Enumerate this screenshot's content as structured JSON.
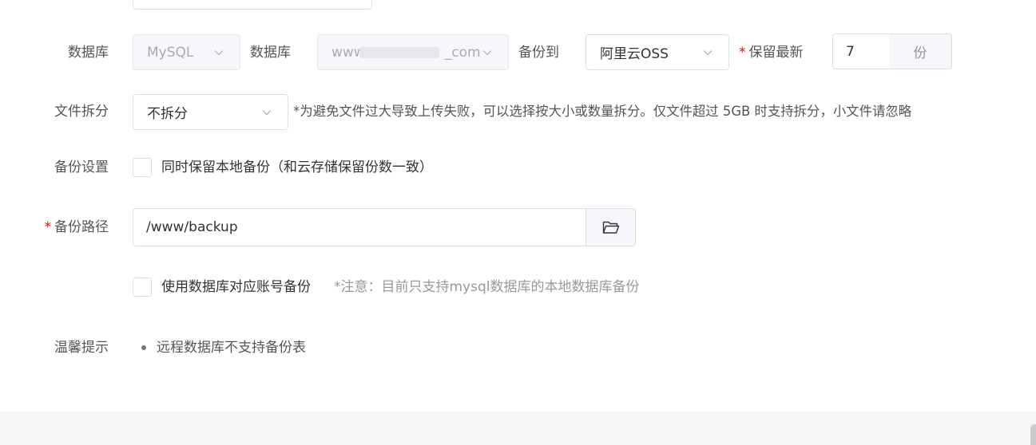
{
  "row_db": {
    "label": "数据库",
    "db_type": {
      "value": "MySQL"
    },
    "db_label": "数据库",
    "db_name": {
      "prefix": "www",
      "suffix": "_com"
    },
    "backup_to_label": "备份到",
    "backup_to": {
      "value": "阿里云OSS"
    },
    "keep_label": "保留最新",
    "keep_count": {
      "value": "7",
      "unit": "份"
    }
  },
  "row_split": {
    "label": "文件拆分",
    "value": "不拆分",
    "hint": "*为避免文件过大导致上传失败，可以选择按大小或数量拆分。仅文件超过 5GB 时支持拆分，小文件请忽略"
  },
  "row_backup_setting": {
    "label": "备份设置",
    "checkbox_label": "同时保留本地备份（和云存储保留份数一致）"
  },
  "row_path": {
    "label": "备份路径",
    "value": "/www/backup"
  },
  "row_account": {
    "checkbox_label": "使用数据库对应账号备份",
    "hint": "*注意：目前只支持mysql数据库的本地数据库备份"
  },
  "row_tips": {
    "label": "温馨提示",
    "items": [
      "远程数据库不支持备份表"
    ]
  },
  "icons": {
    "chevron": "chevron-down-icon",
    "folder": "folder-open-icon"
  },
  "colors": {
    "required": "#ef0808",
    "border": "#dcdfe6",
    "disabled_bg": "#f5f7fa",
    "hint": "#999999"
  }
}
